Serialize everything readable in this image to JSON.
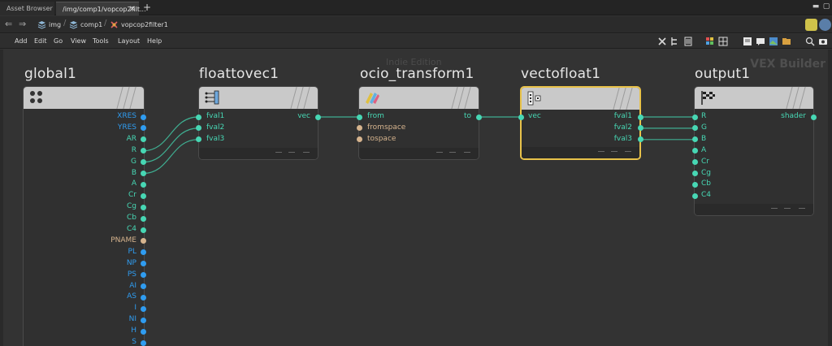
{
  "tabs": [
    {
      "label": "Asset Browser"
    },
    {
      "label": "/img/comp1/vopcop2filt..."
    }
  ],
  "tab_add": "+",
  "path": {
    "crumbs": [
      {
        "label": "img",
        "icon": "img-network-icon"
      },
      {
        "label": "comp1",
        "icon": "comp-network-icon"
      },
      {
        "label": "vopcop2filter1",
        "icon": "vop-network-icon"
      }
    ]
  },
  "menu": [
    "Add",
    "Edit",
    "Go",
    "View",
    "Tools",
    "Layout",
    "Help"
  ],
  "watermark": "Indie Edition",
  "context_label": "VEX Builder",
  "nodes": {
    "global1": {
      "title": "global1",
      "outputs": [
        "XRES",
        "YRES",
        "AR",
        "R",
        "G",
        "B",
        "A",
        "Cr",
        "Cg",
        "Cb",
        "C4",
        "PNAME",
        "PL",
        "NP",
        "PS",
        "AI",
        "AS",
        "I",
        "NI",
        "H",
        "S"
      ]
    },
    "floattovec1": {
      "title": "floattovec1",
      "inputs": [
        "fval1",
        "fval2",
        "fval3"
      ],
      "outputs": [
        "vec"
      ]
    },
    "ocio_transform1": {
      "title": "ocio_transform1",
      "inputs": [
        "from",
        "fromspace",
        "tospace"
      ],
      "outputs": [
        "to"
      ]
    },
    "vectofloat1": {
      "title": "vectofloat1",
      "inputs": [
        "vec"
      ],
      "outputs": [
        "fval1",
        "fval2",
        "fval3"
      ]
    },
    "output1": {
      "title": "output1",
      "inputs": [
        "R",
        "G",
        "B",
        "A",
        "Cr",
        "Cg",
        "Cb",
        "C4"
      ],
      "outputs": [
        "shader"
      ]
    }
  },
  "colors": {
    "wire": "#3fae91",
    "port_float": "#47d7b4",
    "port_int": "#2f9cf0",
    "port_string": "#d6b48e",
    "selected_border": "#e8c24a"
  }
}
